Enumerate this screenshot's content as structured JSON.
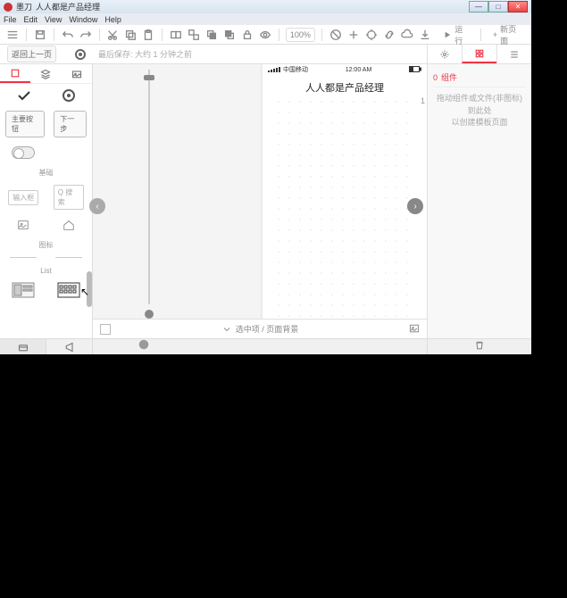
{
  "titlebar": {
    "app": "墨刀",
    "doc": "人人都是产品经理"
  },
  "menu": {
    "file": "File",
    "edit": "Edit",
    "view": "View",
    "window": "Window",
    "help": "Help"
  },
  "toolbar": {
    "zoom": "100%",
    "run_label": "运行",
    "new_label": "新页面"
  },
  "secbar": {
    "back": "返回上一页",
    "last_save": "最后保存: 大约 1 分钟之前"
  },
  "left": {
    "sections": {
      "base": "基础",
      "icons": "图标",
      "list": "List"
    },
    "btn_main": "主要按钮",
    "btn_next": "下一步",
    "input_label": "输入框",
    "search_placeholder": "Q 搜索"
  },
  "device": {
    "carrier": "中国移动",
    "time": "12:00 AM",
    "title": "人人都是产品经理"
  },
  "canvas_footer": {
    "dropdown": "选中项 / 页面背景"
  },
  "right": {
    "widgets_label": "组件",
    "placeholder_l1": "拖动组件或文件(非图标)到此处",
    "placeholder_l2": "以创建模板页面",
    "badge_count": "0",
    "page_count": "1"
  }
}
